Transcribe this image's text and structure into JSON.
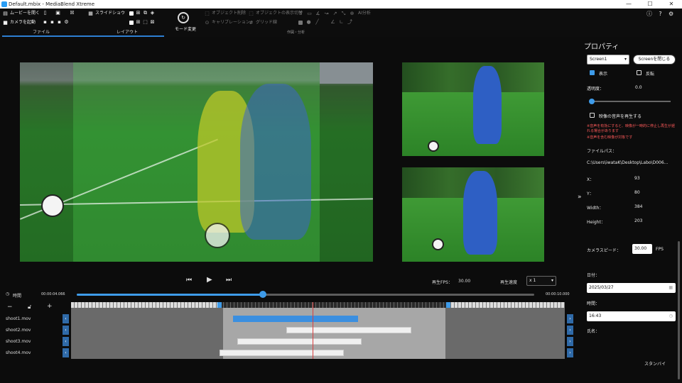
{
  "window": {
    "title": "Default.mbix - MediaBlend Xtreme",
    "minimize": "—",
    "maximize": "☐",
    "close": "✕"
  },
  "ribbon": {
    "open_movie": "ムービーを開く",
    "start_camera": "カメラを起動",
    "slideshow": "スライドショウ",
    "mode_change": "モード変更",
    "object_delete": "オブジェクト削除",
    "object_display_toggle": "オブジェクトの表示切替",
    "calibration": "キャリブレーション",
    "grid": "グリッド線",
    "ai_analysis": "AI分析",
    "tab_file": "ファイル",
    "tab_layout": "レイアウト",
    "group_composition": "作図・分析"
  },
  "player": {
    "playback_fps_label": "再生FPS：",
    "playback_fps_value": "30.00",
    "playback_speed_label": "再生速度",
    "speed_value": "x 1"
  },
  "timeline": {
    "time_label": "時間",
    "current_time": "00:00:04.066",
    "end_time": "00:00:10.000",
    "minus": "−",
    "plus": "+",
    "tracks": [
      {
        "name": "shoot1.mov",
        "clip_start": 0.328,
        "clip_len": 0.253,
        "selected": true
      },
      {
        "name": "shoot2.mov",
        "clip_start": 0.436,
        "clip_len": 0.253,
        "selected": false
      },
      {
        "name": "shoot3.mov",
        "clip_start": 0.336,
        "clip_len": 0.253,
        "selected": false
      },
      {
        "name": "shoot4.mov",
        "clip_start": 0.3,
        "clip_len": 0.253,
        "selected": false
      }
    ],
    "progress": 0.407
  },
  "properties": {
    "heading": "プロパティ",
    "screen_select": "Screen1",
    "close_screen": "Screenを閉じる",
    "show": "表示",
    "show_checked": true,
    "flip": "反転",
    "flip_checked": false,
    "opacity_label": "透明度：",
    "opacity_value": "0.0",
    "play_audio": "映像の音声を再生する",
    "warning_1": "※音声を有効にすると、映像が一時的に停止し再生が遅れる場合があります",
    "warning_2": "※音声を含む映像が対象です",
    "file_path_label": "ファイルパス：",
    "file_path_value": "C:\\Users\\iwataK\\Desktop\\Labo\\D006...",
    "x_label": "X：",
    "x_value": "93",
    "y_label": "Y：",
    "y_value": "80",
    "width_label": "Width：",
    "width_value": "384",
    "height_label": "Height：",
    "height_value": "203",
    "camera_speed_label": "カメラスピード：",
    "camera_speed_value": "30.00",
    "fps_unit": "FPS",
    "date_label": "日付：",
    "date_value": "2025/03/27",
    "time_label": "時間：",
    "time_value": "16:43",
    "name_label": "氏名：",
    "name_value": "",
    "standby": "スタンバイ",
    "expand_icon": "»"
  },
  "colors": {
    "accent": "#3e9be9",
    "warning": "#ff5a5a",
    "playhead": "#d84040"
  }
}
